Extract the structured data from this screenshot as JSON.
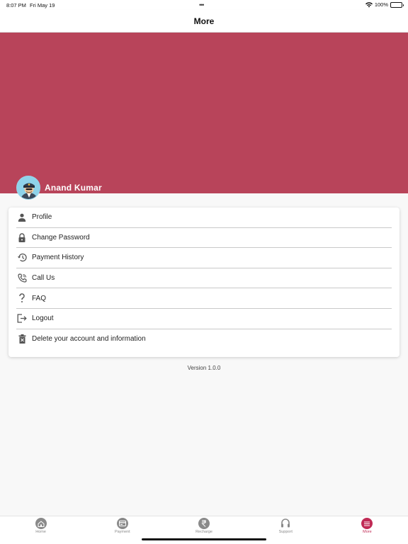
{
  "status_bar": {
    "time": "8:07 PM",
    "date": "Fri May 19",
    "battery": "100%"
  },
  "header": {
    "title": "More"
  },
  "profile": {
    "name": "Anand Kumar"
  },
  "menu": {
    "items": [
      {
        "label": "Profile",
        "icon": "person-icon"
      },
      {
        "label": "Change Password",
        "icon": "lock-icon"
      },
      {
        "label": "Payment History",
        "icon": "history-icon"
      },
      {
        "label": "Call Us",
        "icon": "phone-icon"
      },
      {
        "label": "FAQ",
        "icon": "question-icon"
      },
      {
        "label": "Logout",
        "icon": "logout-icon"
      },
      {
        "label": "Delete your account and information",
        "icon": "trash-icon"
      }
    ]
  },
  "version": "Version 1.0.0",
  "tabs": [
    {
      "label": "Home",
      "icon": "home-icon",
      "active": false
    },
    {
      "label": "Payment",
      "icon": "payment-icon",
      "active": false
    },
    {
      "label": "Recharge",
      "icon": "rupee-icon",
      "active": false
    },
    {
      "label": "Support",
      "icon": "headset-icon",
      "active": false
    },
    {
      "label": "More",
      "icon": "menu-icon",
      "active": true
    }
  ],
  "colors": {
    "accent": "#c02b55",
    "hero": "#b8445a"
  }
}
